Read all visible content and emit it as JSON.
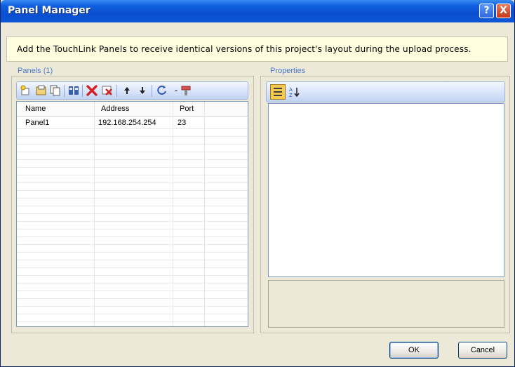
{
  "window": {
    "title": "Panel Manager",
    "help_glyph": "?",
    "close_glyph": "X"
  },
  "banner": {
    "text": "Add the TouchLink Panels to receive identical versions of this project's layout during the upload process."
  },
  "panels": {
    "label": "Panels (1)",
    "columns": [
      "Name",
      "Address",
      "Port"
    ],
    "rows": [
      {
        "name": "Panel1",
        "address": "192.168.254.254",
        "port": "23"
      }
    ]
  },
  "properties": {
    "label": "Properties"
  },
  "buttons": {
    "ok": "OK",
    "cancel": "Cancel"
  },
  "icons": {
    "toolbar": [
      "add-panel-icon",
      "import-panel-icon",
      "copy-panel-icon",
      "discover-panels-icon",
      "delete-icon",
      "remove-all-icon",
      "move-up-icon",
      "move-down-icon",
      "refresh-icon",
      "tools-dropdown-icon"
    ],
    "properties_toolbar": [
      "categorized-icon",
      "sort-alphabetical-icon"
    ]
  },
  "colors": {
    "title_bar": "#0a4fcf",
    "banner_bg": "#ffffe0",
    "dialog_bg": "#ece9d8",
    "delete_red": "#d42020"
  }
}
